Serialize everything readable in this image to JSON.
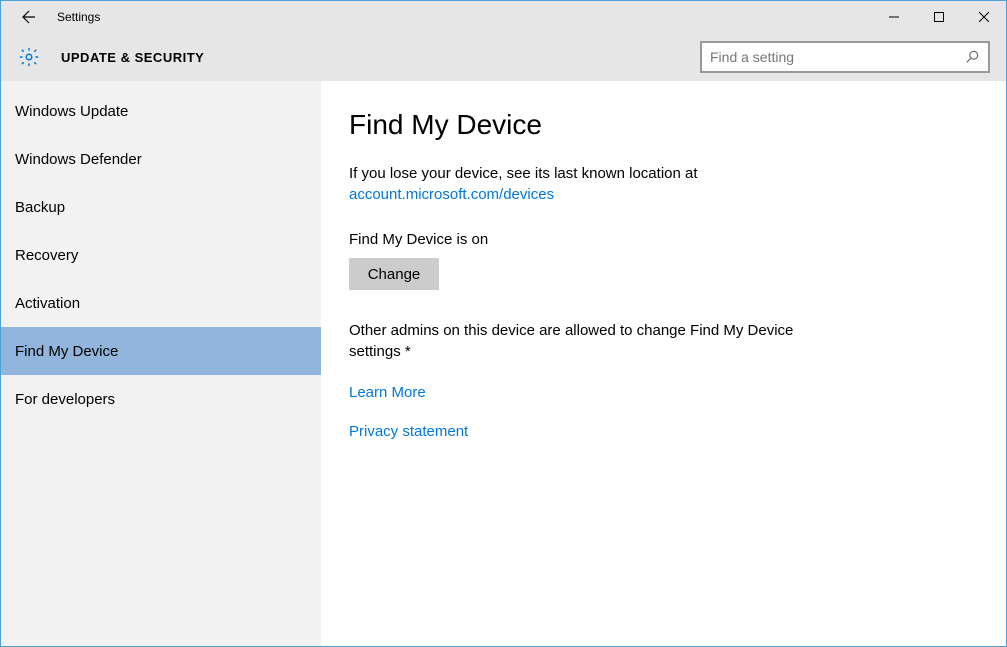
{
  "window": {
    "title": "Settings"
  },
  "header": {
    "title": "UPDATE & SECURITY",
    "search_placeholder": "Find a setting"
  },
  "sidebar": {
    "items": [
      {
        "label": "Windows Update",
        "selected": false
      },
      {
        "label": "Windows Defender",
        "selected": false
      },
      {
        "label": "Backup",
        "selected": false
      },
      {
        "label": "Recovery",
        "selected": false
      },
      {
        "label": "Activation",
        "selected": false
      },
      {
        "label": "Find My Device",
        "selected": true
      },
      {
        "label": "For developers",
        "selected": false
      }
    ]
  },
  "content": {
    "title": "Find My Device",
    "description_prefix": "If you lose your device, see its last known location at ",
    "description_link": "account.microsoft.com/devices",
    "status": "Find My Device is on",
    "change_button": "Change",
    "note": "Other admins on this device are allowed to change Find My Device settings *",
    "learn_more": "Learn More",
    "privacy": "Privacy statement"
  }
}
